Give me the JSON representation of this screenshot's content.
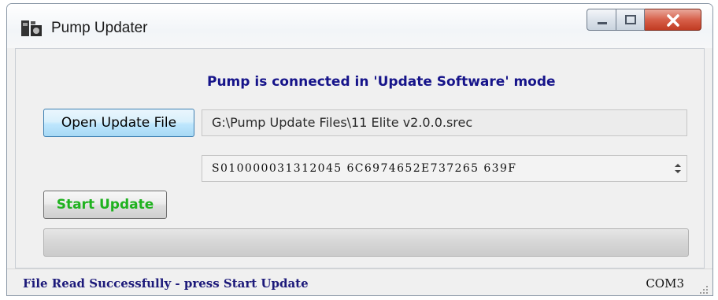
{
  "window": {
    "title": "Pump Updater",
    "app_icon": "pump-updater-app-icon",
    "caption_buttons": [
      "minimize-icon",
      "maximize-icon",
      "close-icon"
    ]
  },
  "main": {
    "connection_status": "Pump is connected in 'Update Software' mode",
    "open_button_label": "Open Update File",
    "file_path": "G:\\Pump Update Files\\11 Elite v2.0.0.srec",
    "srec_record": "S010000031312045 6C6974652E737265 639F",
    "start_button_label": "Start Update",
    "progress": 0
  },
  "statusbar": {
    "message": "File Read Successfully - press Start Update",
    "port": "COM3"
  },
  "colors": {
    "status_blue": "#16148a",
    "start_green": "#1fb21f",
    "close_red": "#c13b22"
  }
}
